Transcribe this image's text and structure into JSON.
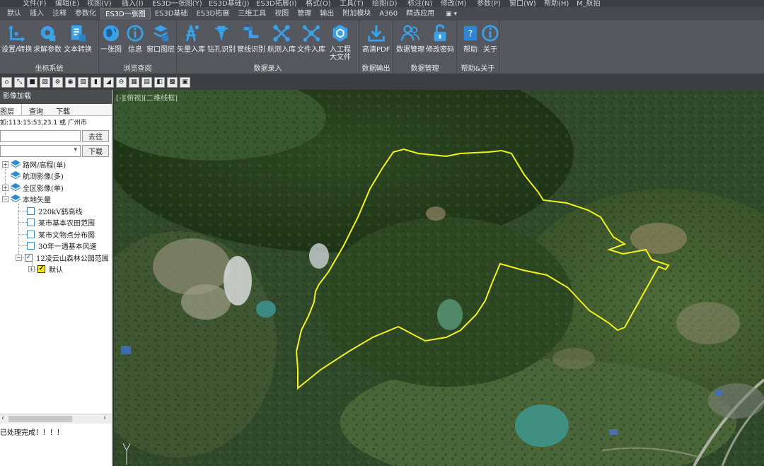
{
  "menubar": {
    "items": [
      "文件(F)",
      "编辑(E)",
      "视图(V)",
      "插入(I)",
      "ES3D一张图(Y)",
      "ES3D基础(J)",
      "ES3D拓展(I)",
      "格式(O)",
      "工具(T)",
      "绘图(D)",
      "标注(N)",
      "修改(M)",
      "参数(P)",
      "窗口(W)",
      "帮助(H)",
      "M_航拍"
    ]
  },
  "tabs": {
    "items": [
      "默认",
      "插入",
      "注释",
      "参数化",
      "ES3D一张图",
      "ES3D基础",
      "ES3D拓展",
      "三维工具",
      "视图",
      "管理",
      "输出",
      "附加模块",
      "A360",
      "精选应用"
    ],
    "active": "ES3D一张图"
  },
  "ribbon": {
    "groups": [
      {
        "title": "坐标系统",
        "buttons": [
          {
            "label": "设置/转换",
            "icon": "coordinate-axis-icon"
          },
          {
            "label": "求解参数",
            "icon": "gear-compute-icon"
          },
          {
            "label": "文本转换",
            "icon": "text-convert-icon"
          }
        ]
      },
      {
        "title": "浏览查阅",
        "buttons": [
          {
            "label": "一张图",
            "icon": "globe-icon"
          },
          {
            "label": "信息",
            "icon": "info-icon"
          },
          {
            "label": "窗口图层",
            "icon": "window-layer-icon"
          }
        ]
      },
      {
        "title": "数据录入",
        "buttons": [
          {
            "label": "矢量入库",
            "icon": "tower-icon"
          },
          {
            "label": "钻孔识别",
            "icon": "drill-icon"
          },
          {
            "label": "管线识别",
            "icon": "pipeline-icon"
          },
          {
            "label": "航测入库",
            "icon": "drone-icon"
          },
          {
            "label": "文件入库",
            "icon": "network-nodes-icon"
          },
          {
            "label": "入工程\n大文件",
            "icon": "hexagon-icon"
          }
        ]
      },
      {
        "title": "数据输出",
        "buttons": [
          {
            "label": "高清PDF",
            "icon": "download-icon"
          }
        ]
      },
      {
        "title": "数据管理",
        "buttons": [
          {
            "label": "数据管理",
            "icon": "users-icon"
          },
          {
            "label": "修改密码",
            "icon": "lock-icon"
          }
        ]
      },
      {
        "title": "帮助&关于",
        "buttons": [
          {
            "label": "帮助",
            "icon": "help-book-icon"
          },
          {
            "label": "关于",
            "icon": "info-icon"
          }
        ]
      }
    ]
  },
  "leftpanel": {
    "title": "影像加载",
    "tabs": [
      "图层",
      "查询",
      "下载"
    ],
    "coord_hint": "如:113:15:53,23.1 或 广州市",
    "go_button": "去往",
    "download_button": "下载",
    "tree": [
      {
        "label": "路网/高程(单)",
        "type": "group",
        "expanded": false
      },
      {
        "label": "航测影像(多)",
        "type": "group",
        "expanded": false
      },
      {
        "label": "全区影像(单)",
        "type": "group",
        "expanded": false
      },
      {
        "label": "本地矢量",
        "type": "group",
        "expanded": true
      },
      {
        "label": "220kV鹤高线",
        "type": "layer",
        "checked": false
      },
      {
        "label": "某市基本农田范围",
        "type": "layer",
        "checked": false
      },
      {
        "label": "某市文物点分布图",
        "type": "layer",
        "checked": false
      },
      {
        "label": "30年一遇基本风速",
        "type": "layer",
        "checked": false
      },
      {
        "label": "12凌云山森林公园范围",
        "type": "layer",
        "checked": true
      },
      {
        "label": "默认",
        "type": "style",
        "checked": true
      }
    ],
    "status": "已处理完成！！！！"
  },
  "map": {
    "view_label": "[-][俯视][二维线框]",
    "boundary_color": "#f2f21a"
  }
}
